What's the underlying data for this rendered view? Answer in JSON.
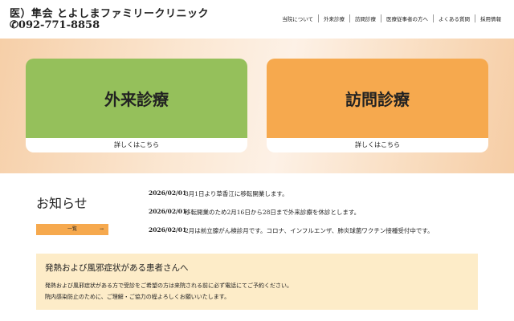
{
  "header": {
    "logo": "医）隼会 とよしまファミリークリニック",
    "tel": "092-771-8858",
    "nav": [
      "当院について",
      "外来診療",
      "訪問診療",
      "医療従事者の方へ",
      "よくある質問",
      "採用情報"
    ]
  },
  "cards": [
    {
      "title": "外来診療",
      "link": "詳しくはこちら",
      "color": "#95c05b"
    },
    {
      "title": "訪問診療",
      "link": "詳しくはこちら",
      "color": "#f6a94e"
    }
  ],
  "news": {
    "title": "お知らせ",
    "list_button": "一覧",
    "arrow": "→",
    "items": [
      {
        "date": "2026/02/01",
        "text": "3月1日より草香江に移転開業します。"
      },
      {
        "date": "2026/02/01",
        "text": "移転開業のため2月16日から28日まで外来診療を休診とします。"
      },
      {
        "date": "2026/02/01",
        "text": "2月は前立腺がん検診月です。コロナ、インフルエンザ、肺炎球菌ワクチン接種受付中です。"
      }
    ]
  },
  "notice": {
    "title": "発熱および風邪症状がある患者さんへ",
    "lines": [
      "発熱および風邪症状がある方で受診をご希望の方は来院される前に必ず電話にてご予約ください。",
      "院内感染防止のために、ご理解・ご協力の程よろしくお願いいたします。"
    ]
  }
}
